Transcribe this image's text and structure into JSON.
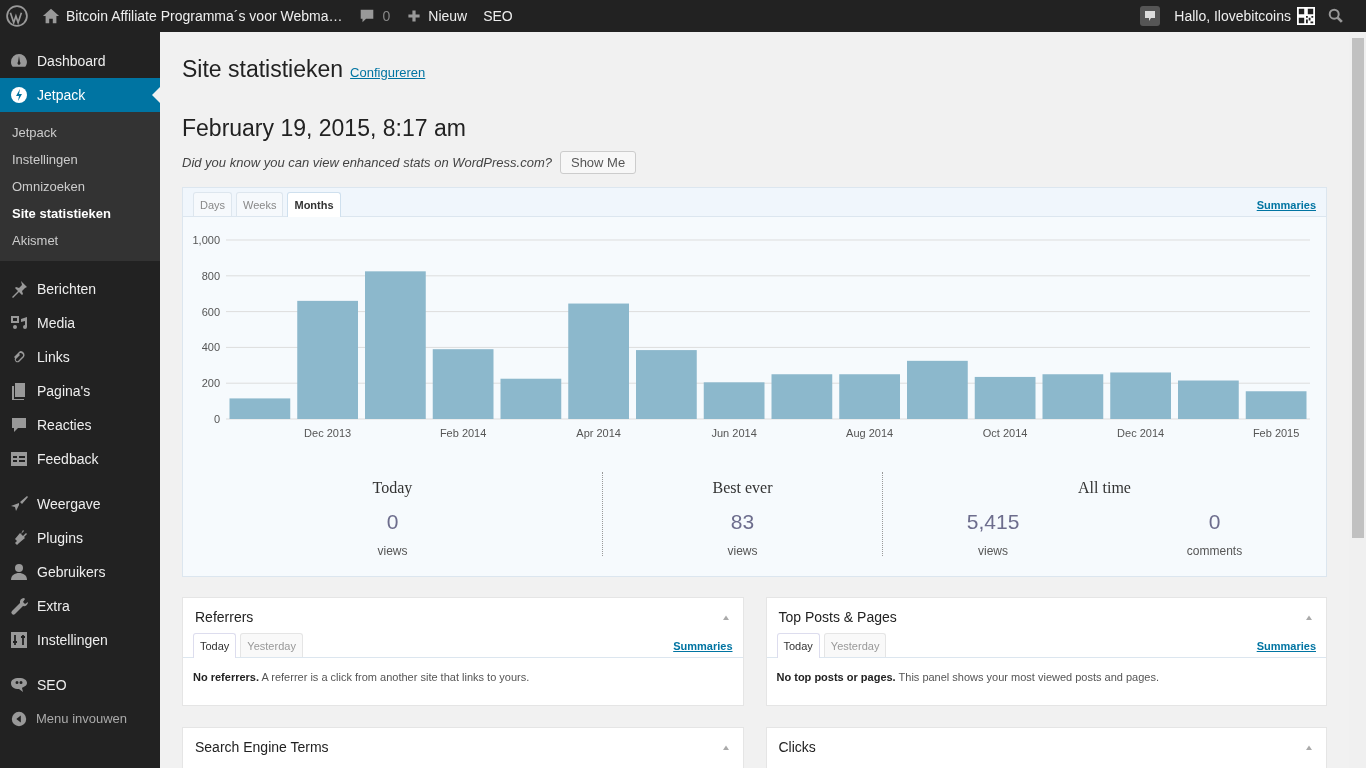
{
  "top_bar": {
    "site_title": "Bitcoin Affiliate Programma´s voor Webma…",
    "comments_count": "0",
    "new_label": "Nieuw",
    "seo_label": "SEO",
    "greeting": "Hallo, Ilovebitcoins"
  },
  "sidebar": {
    "groups": [
      [
        {
          "label": "Dashboard",
          "selected": false
        },
        {
          "label": "Jetpack",
          "selected": true,
          "children": [
            {
              "label": "Jetpack",
              "selected": false
            },
            {
              "label": "Instellingen",
              "selected": false
            },
            {
              "label": "Omnizoeken",
              "selected": false
            },
            {
              "label": "Site statistieken",
              "selected": true
            },
            {
              "label": "Akismet",
              "selected": false
            }
          ]
        }
      ],
      [
        {
          "label": "Berichten",
          "selected": false
        },
        {
          "label": "Media",
          "selected": false
        },
        {
          "label": "Links",
          "selected": false
        },
        {
          "label": "Pagina's",
          "selected": false
        },
        {
          "label": "Reacties",
          "selected": false
        },
        {
          "label": "Feedback",
          "selected": false
        }
      ],
      [
        {
          "label": "Weergave",
          "selected": false
        },
        {
          "label": "Plugins",
          "selected": false
        },
        {
          "label": "Gebruikers",
          "selected": false
        },
        {
          "label": "Extra",
          "selected": false
        },
        {
          "label": "Instellingen",
          "selected": false
        }
      ],
      [
        {
          "label": "SEO",
          "selected": false
        }
      ]
    ],
    "collapse_label": "Menu invouwen"
  },
  "page": {
    "title": "Site statistieken",
    "configure_link": "Configureren",
    "date": "February 19, 2015, 8:17 am",
    "promo": "Did you know you can view enhanced stats on WordPress.com?",
    "promo_button": "Show Me"
  },
  "stats": {
    "tabs": [
      {
        "label": "Days",
        "selected": false
      },
      {
        "label": "Weeks",
        "selected": false
      },
      {
        "label": "Months",
        "selected": true
      }
    ],
    "summaries_link": "Summaries",
    "chart_data": {
      "type": "bar",
      "categories": [
        null,
        "Dec 2013",
        null,
        "Feb 2014",
        null,
        "Apr 2014",
        null,
        "Jun 2014",
        null,
        "Aug 2014",
        null,
        "Oct 2014",
        null,
        "Dec 2014",
        null,
        "Feb 2015"
      ],
      "values": [
        115,
        660,
        825,
        390,
        225,
        645,
        385,
        205,
        250,
        250,
        325,
        235,
        250,
        260,
        215,
        155
      ],
      "grid": true,
      "ylim": [
        0,
        1000
      ],
      "yticks": [
        0,
        200,
        400,
        600,
        800,
        {
          "value": 1000,
          "label": "1,000"
        }
      ]
    },
    "highlights": [
      {
        "title": "Today",
        "items": [
          {
            "value": "0",
            "label": "views"
          }
        ]
      },
      {
        "title": "Best ever",
        "items": [
          {
            "value": "83",
            "label": "views"
          }
        ]
      },
      {
        "title": "All time",
        "items": [
          {
            "value": "5,415",
            "label": "views"
          },
          {
            "value": "0",
            "label": "comments"
          }
        ]
      }
    ]
  },
  "panels": [
    {
      "title": "Referrers",
      "tabs": [
        {
          "label": "Today",
          "selected": true
        },
        {
          "label": "Yesterday",
          "selected": false
        }
      ],
      "summaries_link": "Summaries",
      "message": "**No referrers.** A referrer is a click from another site that links to yours."
    },
    {
      "title": "Top Posts & Pages",
      "tabs": [
        {
          "label": "Today",
          "selected": true
        },
        {
          "label": "Yesterday",
          "selected": false
        }
      ],
      "summaries_link": "Summaries",
      "message": "**No top posts or pages.** This panel shows your most viewed posts and pages."
    },
    {
      "title": "Search Engine Terms"
    },
    {
      "title": "Clicks"
    }
  ]
}
